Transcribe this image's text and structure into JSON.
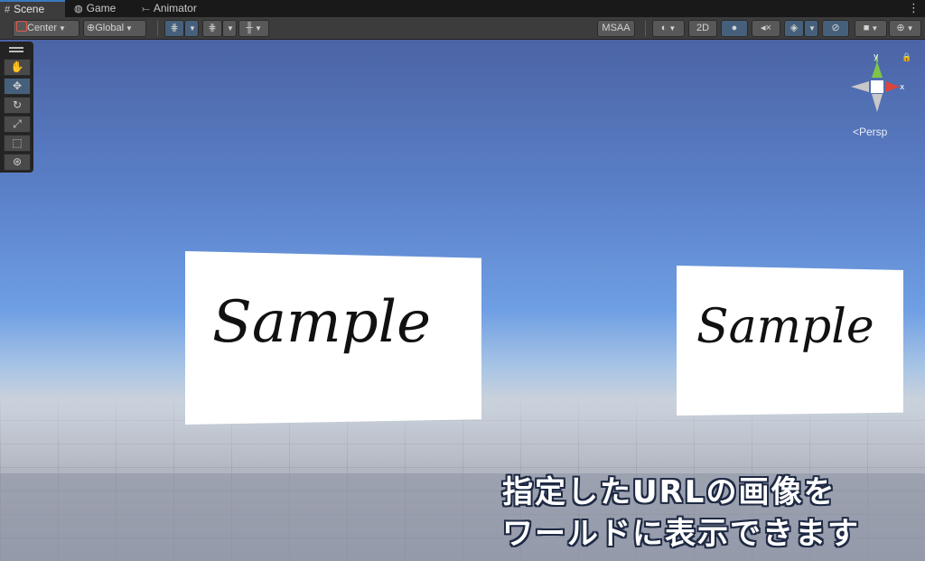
{
  "tabs": [
    {
      "label": "Scene",
      "icon": "grid-icon",
      "active": true
    },
    {
      "label": "Game",
      "icon": "gamepad-icon",
      "active": false
    },
    {
      "label": "Animator",
      "icon": "animator-icon",
      "active": false
    }
  ],
  "toolbar": {
    "pivot_label": "Center",
    "space_label": "Global",
    "msaa_label": "MSAA",
    "mode_2d_label": "2D"
  },
  "scene": {
    "board1_text": "Sample",
    "board2_text": "Sample",
    "persp_label": "<Persp",
    "axis_x": "x",
    "axis_y": "y",
    "caption_line1": "指定したURLの画像を",
    "caption_line2": "ワールドに表示できます"
  },
  "colors": {
    "accent": "#46607c",
    "axis_x": "#d9463c",
    "axis_y": "#7ec44a"
  }
}
